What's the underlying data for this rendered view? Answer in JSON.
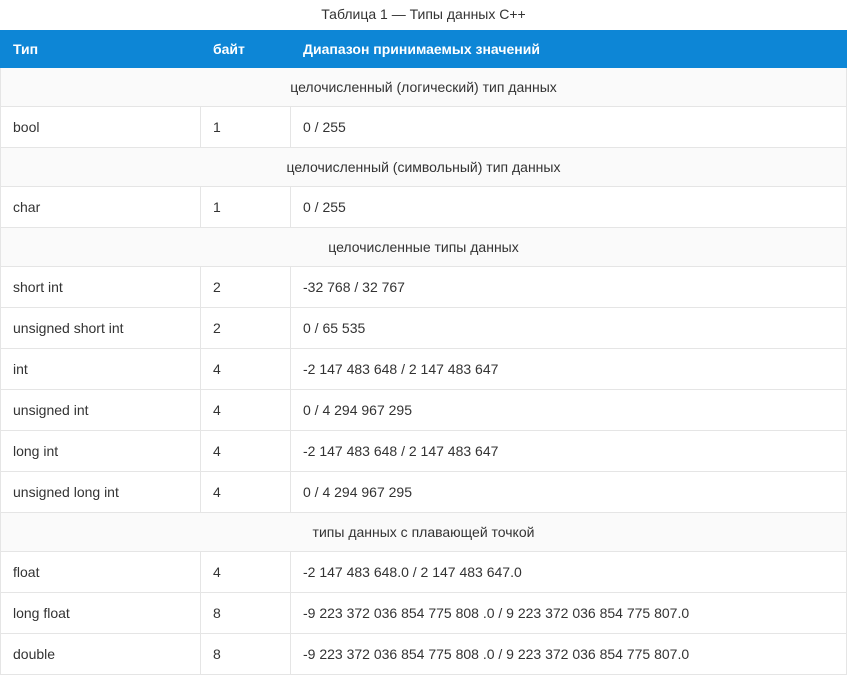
{
  "caption": "Таблица 1 — Типы данных С++",
  "headers": {
    "type": "Тип",
    "bytes": "байт",
    "range": "Диапазон принимаемых значений"
  },
  "sections": [
    {
      "title": "целочисленный (логический) тип данных",
      "rows": [
        {
          "type": "bool",
          "bytes": "1",
          "range": "0   /   255"
        }
      ]
    },
    {
      "title": "целочисленный (символьный) тип данных",
      "rows": [
        {
          "type": "char",
          "bytes": "1",
          "range": "0   /   255"
        }
      ]
    },
    {
      "title": "целочисленные типы данных",
      "rows": [
        {
          "type": "short int",
          "bytes": "2",
          "range": "-32 768    /    32 767"
        },
        {
          "type": "unsigned short int",
          "bytes": "2",
          "range": "0  /  65 535"
        },
        {
          "type": "int",
          "bytes": "4",
          "range": "-2 147 483 648  /   2 147 483 647"
        },
        {
          "type": "unsigned int",
          "bytes": "4",
          "range": "0     /    4 294 967 295"
        },
        {
          "type": "long int",
          "bytes": "4",
          "range": "-2 147 483 648    /    2 147 483 647"
        },
        {
          "type": "unsigned long int",
          "bytes": "4",
          "range": "0     /    4 294 967 295"
        }
      ]
    },
    {
      "title": "типы данных с плавающей точкой",
      "rows": [
        {
          "type": "float",
          "bytes": "4",
          "range": "-2 147 483 648.0  / 2 147 483 647.0"
        },
        {
          "type": "long float",
          "bytes": "8",
          "range": "-9 223 372 036 854 775 808 .0   /   9 223 372 036 854 775 807.0"
        },
        {
          "type": "double",
          "bytes": "8",
          "range": "-9 223 372 036 854 775 808 .0   /   9 223 372 036 854 775 807.0"
        }
      ]
    }
  ]
}
